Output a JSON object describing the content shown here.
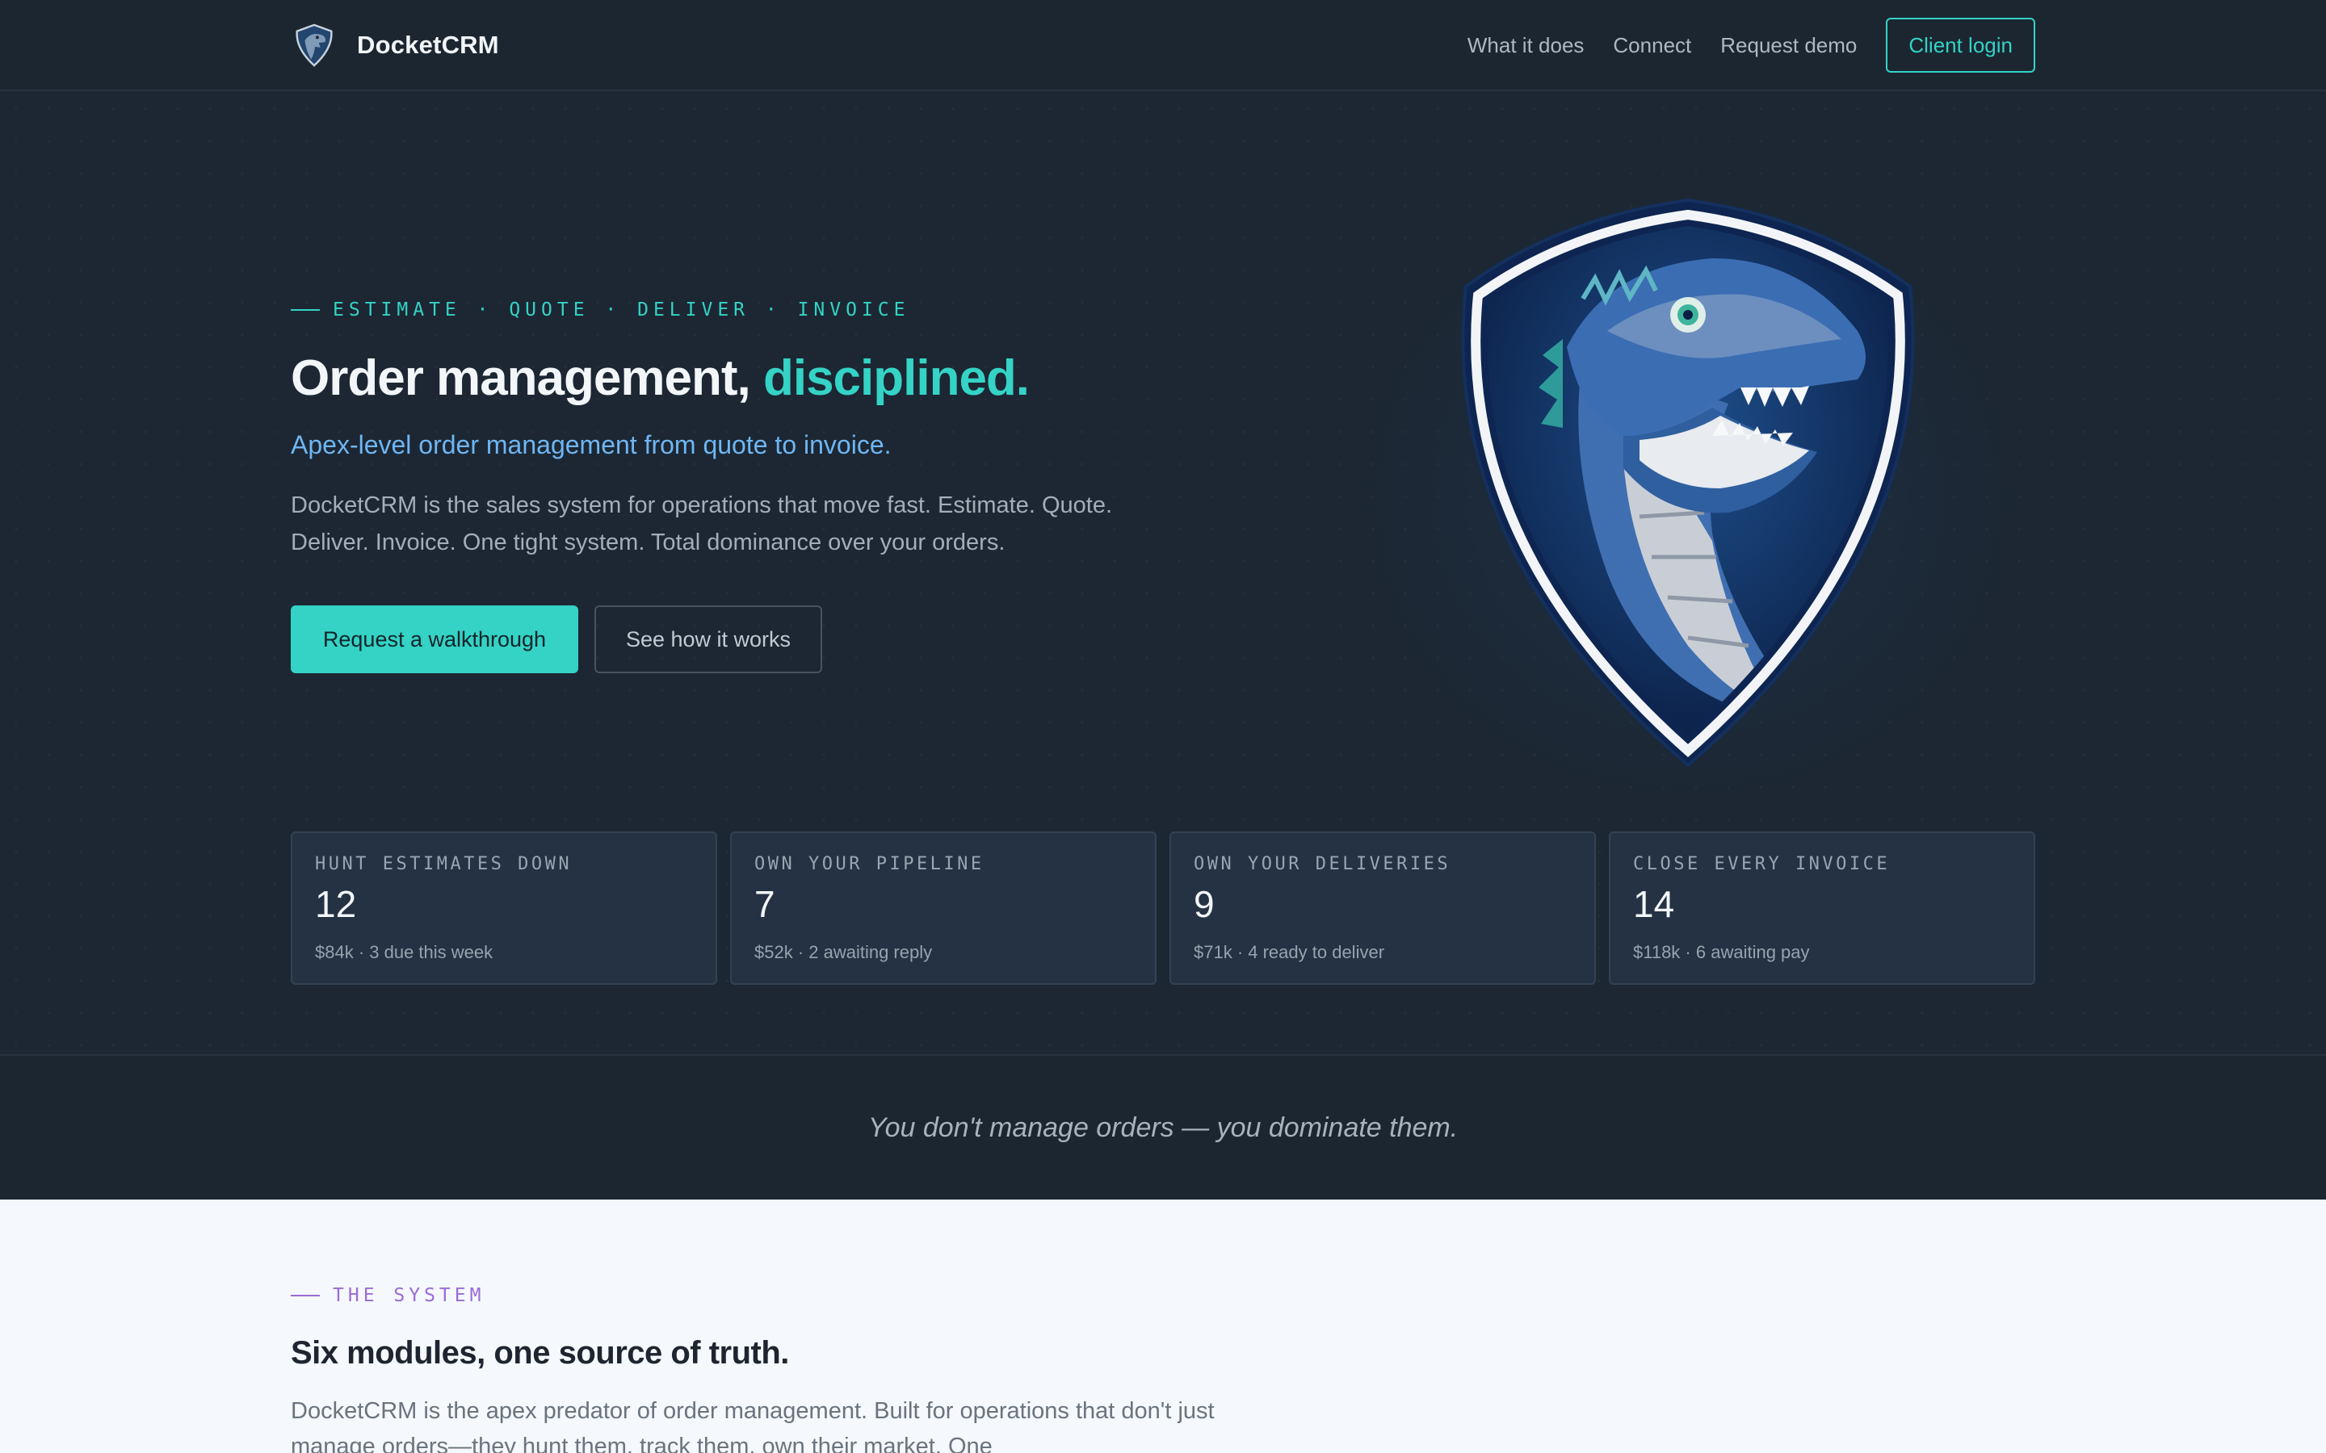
{
  "nav": {
    "brand": "DocketCRM",
    "links": [
      "What it does",
      "Connect",
      "Request demo"
    ],
    "login_label": "Client login"
  },
  "hero": {
    "eyebrow": "ESTIMATE · QUOTE · DELIVER · INVOICE",
    "title_main": "Order management,",
    "title_accent": "disciplined.",
    "subtitle": "Apex-level order management from quote to invoice.",
    "body": "DocketCRM is the sales system for operations that move fast. Estimate. Quote. Deliver. Invoice. One tight system. Total dominance over your orders.",
    "primary_cta": "Request a walkthrough",
    "secondary_cta": "See how it works"
  },
  "stats": [
    {
      "label": "HUNT ESTIMATES DOWN",
      "value": "12",
      "sub": "$84k · 3 due this week"
    },
    {
      "label": "OWN YOUR PIPELINE",
      "value": "7",
      "sub": "$52k · 2 awaiting reply"
    },
    {
      "label": "OWN YOUR DELIVERIES",
      "value": "9",
      "sub": "$71k · 4 ready to deliver"
    },
    {
      "label": "CLOSE EVERY INVOICE",
      "value": "14",
      "sub": "$118k · 6 awaiting pay"
    }
  ],
  "quote": "You don't manage orders — you dominate them.",
  "system": {
    "eyebrow": "THE SYSTEM",
    "title": "Six modules, one source of truth.",
    "body": "DocketCRM is the apex predator of order management. Built for operations that don't just manage orders—they hunt them, track them, own their market. One"
  },
  "colors": {
    "accent": "#34d3c5",
    "subtitle_blue": "#6fb6f2",
    "system_purple": "#9a6bd6",
    "background": "#1b2631"
  },
  "icons": {
    "brand_logo": "dino-shield-logo-icon",
    "mascot": "dino-shield-mascot"
  }
}
